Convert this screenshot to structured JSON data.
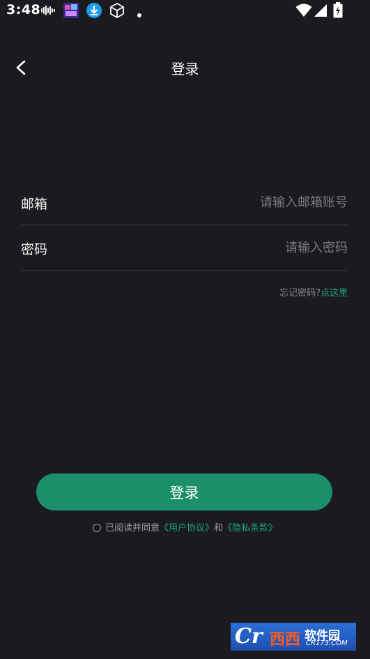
{
  "status_bar": {
    "time": "3:48",
    "icons": [
      "audio-wave-icon",
      "app-thumbnail-icon",
      "download-icon",
      "cube-icon",
      "dot-icon",
      "wifi-icon",
      "signal-icon",
      "battery-charging-icon"
    ]
  },
  "header": {
    "title": "登录",
    "back_icon": "chevron-left-icon"
  },
  "form": {
    "email_label": "邮箱",
    "email_placeholder": "请输入邮箱账号",
    "email_value": "",
    "password_label": "密码",
    "password_placeholder": "请输入密码",
    "password_value": ""
  },
  "forgot": {
    "text": "忘记密码?",
    "link": "点这里"
  },
  "login_button": "登录",
  "agreement": {
    "checked": false,
    "prefix": "已阅读并同意",
    "user_agreement": "《用户协议》",
    "and": "和",
    "privacy_policy": "《隐私条款》"
  },
  "watermark": {
    "brand": "Cr",
    "xixi": "西西",
    "soft": "软件园",
    "domain": "CR173.COM"
  },
  "colors": {
    "background": "#1b1b1f",
    "accent": "#1a8f6a",
    "link": "#1aa37a",
    "divider": "#3a3b40"
  }
}
